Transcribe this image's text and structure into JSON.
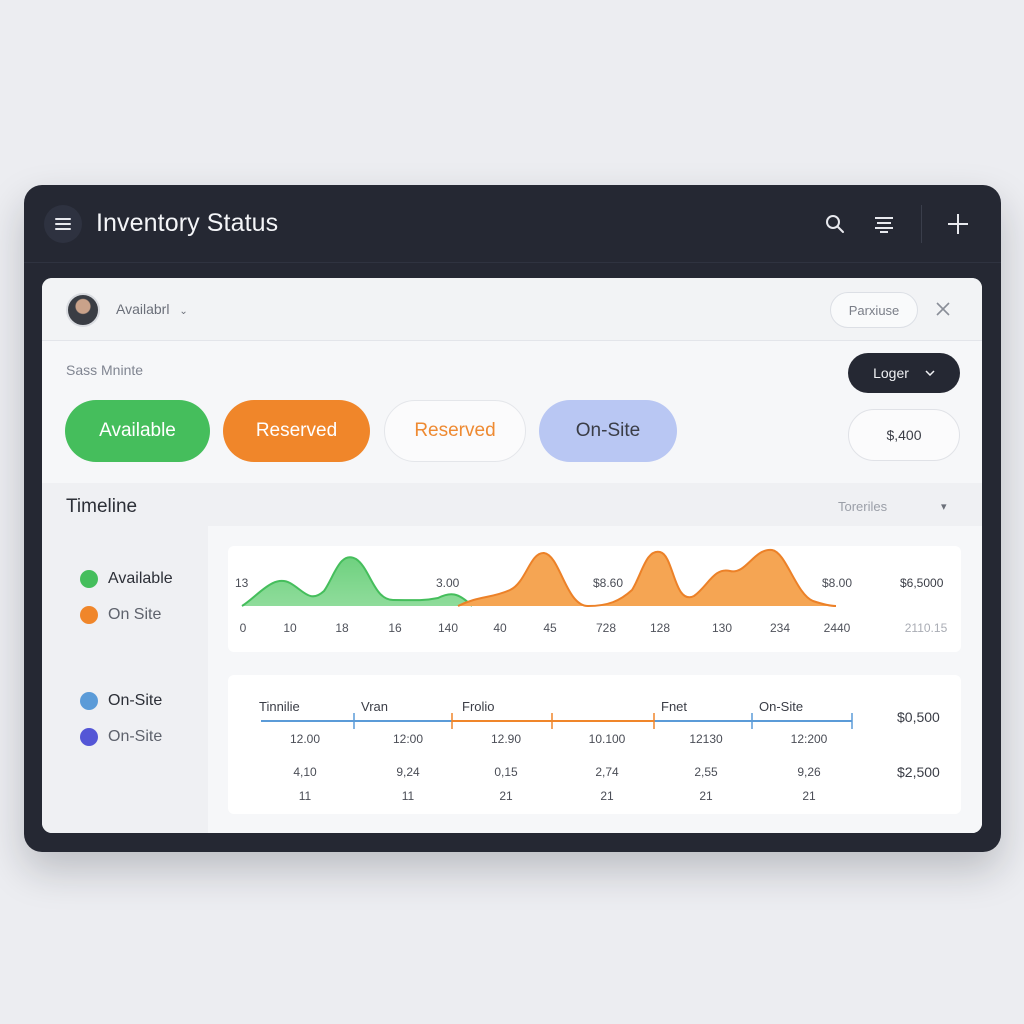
{
  "app": {
    "title": "Inventory Status"
  },
  "toolbar": {
    "menu_icon": "hamburger-icon",
    "search_icon": "search-icon",
    "filter_icon": "filter-list-icon",
    "add_icon": "plus-icon"
  },
  "panel_header": {
    "dropdown_label": "Availabrl",
    "pill_button": "Parxiuse",
    "close_icon": "close-icon"
  },
  "summary": {
    "subtitle": "Sass Mninte",
    "dark_dropdown": "Loger",
    "amount": "$,400",
    "status_buttons": [
      {
        "label": "Available",
        "color": "#45be5c"
      },
      {
        "label": "Reserved",
        "color": "#f0862a"
      },
      {
        "label": "Reserved",
        "color": "#ee8a32"
      },
      {
        "label": "On-Site",
        "color": "#b9c7f3"
      }
    ]
  },
  "timeline": {
    "title": "Timeline",
    "dropdown": "Toreriles",
    "legend_top": [
      {
        "label": "Available",
        "color": "#45be5c"
      },
      {
        "label": "On Site",
        "color": "#f0862a"
      }
    ],
    "legend_bottom": [
      {
        "label": "On-Site",
        "color": "#5b9bd8"
      },
      {
        "label": "On-Site",
        "color": "#5456d6"
      }
    ]
  },
  "chart_data": {
    "type": "area",
    "series": [
      {
        "name": "Available",
        "color": "#45be5c"
      },
      {
        "name": "On Site",
        "color": "#f0862a"
      }
    ],
    "point_labels": [
      "13",
      "3.00",
      "$8.60",
      "$8.00"
    ],
    "right_value": "$6,5000",
    "x_ticks": [
      "0",
      "10",
      "18",
      "16",
      "140",
      "40",
      "45",
      "728",
      "128",
      "130",
      "234",
      "2440"
    ],
    "x_tick_extra": "2110.15"
  },
  "segments": {
    "labels": [
      "Tinnilie",
      "Vran",
      "Frolio",
      "Fnet",
      "On-Site"
    ],
    "row1": [
      "12.00",
      "12:00",
      "12.90",
      "10.100",
      "12130",
      "12:200"
    ],
    "row2": [
      "4,10",
      "9,24",
      "0,15",
      "2,74",
      "2,55",
      "9,26"
    ],
    "row3": [
      "11",
      "11",
      "21",
      "21",
      "21",
      "21"
    ],
    "right_values": [
      "$0,500",
      "$2,500"
    ]
  }
}
